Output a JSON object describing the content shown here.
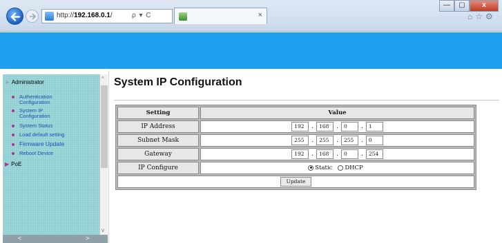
{
  "browser": {
    "url_prefix": "http://",
    "url_host": "192.168.0.1",
    "url_suffix": "/",
    "addr_controls": "ρ ▾ C",
    "tab_close": "×",
    "win_min": "—",
    "win_max": "▢",
    "win_close": "x",
    "tool_icons": "⌂☆⚙"
  },
  "sidebar": {
    "sections": [
      {
        "label": "Administrator",
        "arrow": "➢"
      },
      {
        "label": "PoE",
        "arrow": "▶"
      }
    ],
    "items": [
      {
        "line1": "Authentication",
        "line2": "Configuration"
      },
      {
        "line1": "System IP",
        "line2": "Configuration"
      },
      {
        "line1": "System Status",
        "line2": ""
      },
      {
        "line1": "Load default setting",
        "line2": ""
      },
      {
        "line1": "Firmware Update",
        "line2": ""
      },
      {
        "line1": "Reboot Device",
        "line2": ""
      }
    ],
    "scroll": {
      "left": "<",
      "right": ">",
      "up": "^",
      "down": "v"
    }
  },
  "main": {
    "title": "System IP Configuration",
    "table": {
      "header_setting": "Setting",
      "header_value": "Value",
      "rows": [
        {
          "label": "IP Address",
          "octets": [
            "192",
            "168",
            "0",
            "1"
          ]
        },
        {
          "label": "Subnet Mask",
          "octets": [
            "255",
            "255",
            "255",
            "0"
          ]
        },
        {
          "label": "Gateway",
          "octets": [
            "192",
            "168",
            "0",
            "254"
          ]
        }
      ],
      "ip_configure_label": "IP Configure",
      "static_label": "Static",
      "dhcp_label": "DHCP",
      "selected_mode": "Static",
      "update_button": "Update"
    }
  },
  "colors": {
    "banner": "#1fa0ef",
    "sidebar": "#8fcfd2",
    "link": "#1d4bb5",
    "bullet": "#b02f93"
  }
}
